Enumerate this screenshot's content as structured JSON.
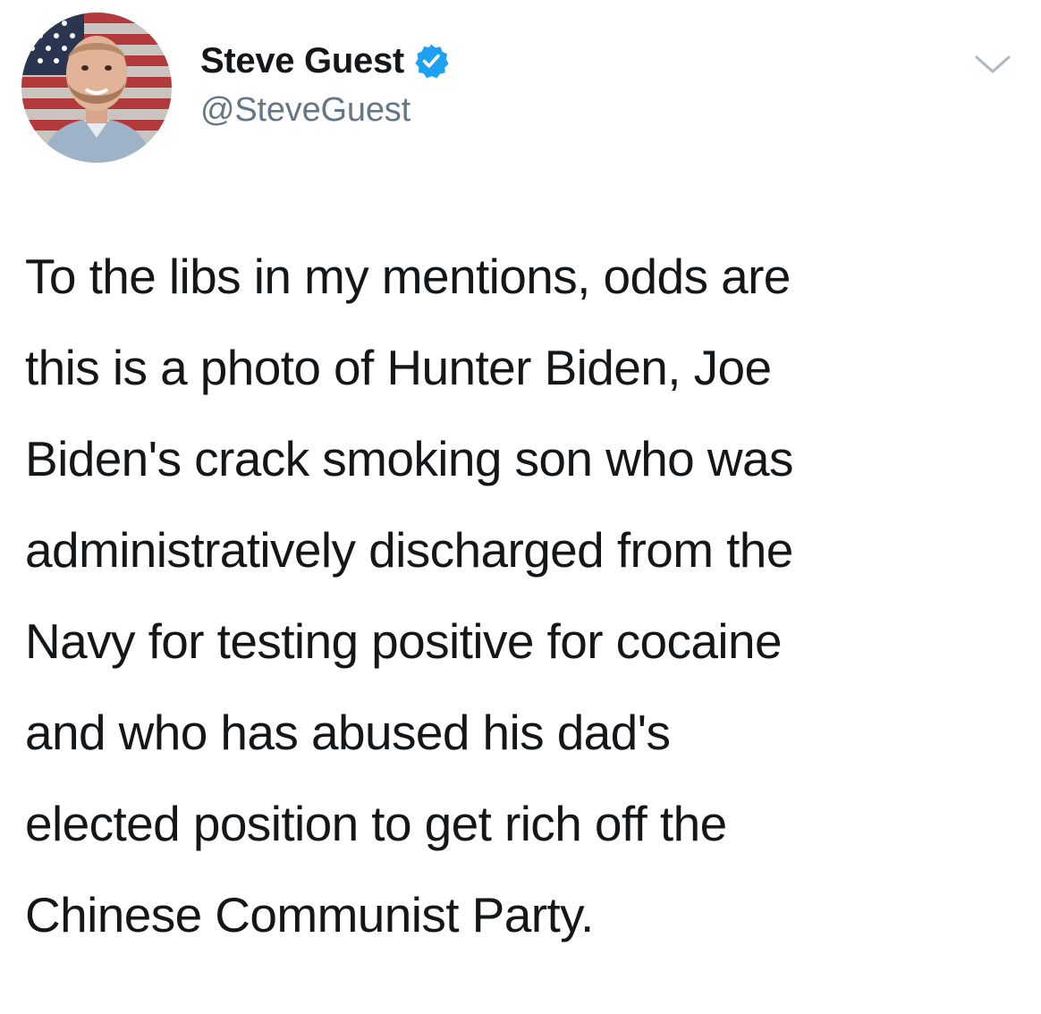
{
  "tweet": {
    "author": {
      "display_name": "Steve Guest",
      "handle": "@SteveGuest",
      "verified": true,
      "avatar": "profile-photo-with-american-flag"
    },
    "menu_icon": "chevron-down-icon",
    "text_lines": [
      "To the libs in my mentions, odds are",
      "this is a photo of Hunter Biden, Joe",
      "Biden's crack smoking son who was",
      "administratively discharged from the",
      "Navy for testing positive for cocaine",
      "and who has abused his dad's",
      "elected position to get rich off the",
      "Chinese Communist Party."
    ]
  },
  "colors": {
    "verified_badge": "#1da1f2",
    "text_primary": "#14171a",
    "text_secondary": "#657786",
    "caret": "#aab8c2"
  }
}
